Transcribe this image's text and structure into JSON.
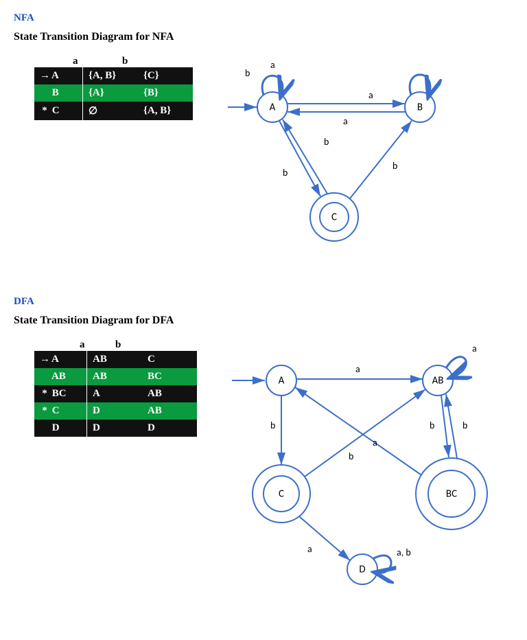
{
  "nfa": {
    "heading": "NFA",
    "subtitle": "State Transition Diagram for NFA",
    "columns": {
      "a": "a",
      "b": "b"
    },
    "rows": [
      {
        "marker": "→",
        "state": "A",
        "a": "{A, B}",
        "b": "{C}",
        "cls": "row-black"
      },
      {
        "marker": "",
        "state": "B",
        "a": "{A}",
        "b": "{B}",
        "cls": "row-green"
      },
      {
        "marker": "*",
        "state": "C",
        "a": "∅",
        "b": "{A, B}",
        "cls": "row-black"
      }
    ],
    "diagram": {
      "nodes": {
        "A": "A",
        "B": "B",
        "C": "C"
      },
      "edges": {
        "A_loop": "a",
        "B_loop": "b",
        "AB_a": "a",
        "BA_a": "a",
        "AC_b": "b",
        "CA_b": "b",
        "CB_b": "b"
      }
    }
  },
  "dfa": {
    "heading": "DFA",
    "subtitle": "State Transition Diagram for DFA",
    "columns": {
      "a": "a",
      "b": "b"
    },
    "rows": [
      {
        "marker": "→",
        "state": "A",
        "a": "AB",
        "b": "C",
        "cls": "row-black"
      },
      {
        "marker": "",
        "state": "AB",
        "a": "AB",
        "b": "BC",
        "cls": "row-green"
      },
      {
        "marker": "*",
        "state": "BC",
        "a": "A",
        "b": "AB",
        "cls": "row-black"
      },
      {
        "marker": "*",
        "state": "C",
        "a": "D",
        "b": "AB",
        "cls": "row-green"
      },
      {
        "marker": "",
        "state": "D",
        "a": "D",
        "b": "D",
        "cls": "row-black"
      }
    ],
    "diagram": {
      "nodes": {
        "A": "A",
        "AB": "AB",
        "C": "C",
        "BC": "BC",
        "D": "D"
      },
      "edges": {
        "A_AB_a": "a",
        "AB_loop_a": "a",
        "A_C_b": "b",
        "AB_BC_b": "b",
        "BC_A_a": "a",
        "BC_AB_b": "b",
        "C_AB_b": "b",
        "C_D_a": "a",
        "D_loop": "a, b"
      }
    }
  }
}
